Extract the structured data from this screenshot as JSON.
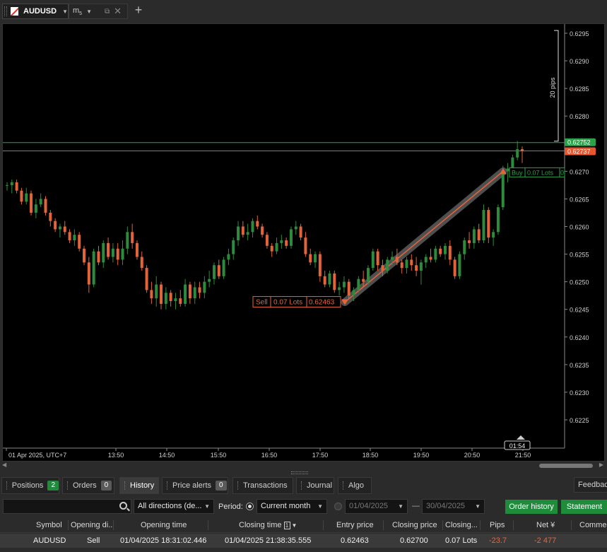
{
  "chart_tab": {
    "symbol": "AUDUSD",
    "timeframe_main": "m",
    "timeframe_sub": "5"
  },
  "chart": {
    "price_axis_labels": [
      "0.6295",
      "0.6290",
      "0.6285",
      "0.6280",
      "0.6270",
      "0.6265",
      "0.6260",
      "0.6255",
      "0.6250",
      "0.6245",
      "0.6240",
      "0.6235",
      "0.6230",
      "0.6225"
    ],
    "time_axis_labels": [
      "01 Apr 2025, UTC+7",
      "13:50",
      "14:50",
      "15:50",
      "16:50",
      "17:50",
      "18:50",
      "19:50",
      "20:50",
      "21:50"
    ],
    "ask_price_tag": "0.62752",
    "bid_price_tag": "0.62737",
    "pips_measure": "20 pips",
    "crosshair_time": "01:54",
    "sell_marker": {
      "side": "Sell",
      "lots": "0.07 Lots",
      "price": "0.62463"
    },
    "buy_marker": {
      "side": "Buy",
      "lots": "0.07 Lots",
      "extra": "0"
    },
    "colors": {
      "bull": "#2e8b3e",
      "bear": "#e2643a",
      "ask": "#2aa34a",
      "bid": "#e8552f"
    }
  },
  "chart_data": {
    "type": "candlestick",
    "candles": [
      [
        0.62675,
        0.6268,
        0.62665,
        0.62675
      ],
      [
        0.62675,
        0.62685,
        0.6266,
        0.6268
      ],
      [
        0.6268,
        0.62685,
        0.6266,
        0.62665
      ],
      [
        0.62665,
        0.6267,
        0.6264,
        0.62645
      ],
      [
        0.62645,
        0.6267,
        0.6264,
        0.6266
      ],
      [
        0.6266,
        0.62665,
        0.6262,
        0.62625
      ],
      [
        0.62625,
        0.6265,
        0.62615,
        0.6264
      ],
      [
        0.6264,
        0.6266,
        0.62635,
        0.6265
      ],
      [
        0.6265,
        0.62655,
        0.6262,
        0.62625
      ],
      [
        0.62625,
        0.6263,
        0.626,
        0.6261
      ],
      [
        0.6261,
        0.62615,
        0.6259,
        0.62595
      ],
      [
        0.62595,
        0.62605,
        0.6258,
        0.626
      ],
      [
        0.626,
        0.6261,
        0.62585,
        0.6259
      ],
      [
        0.6259,
        0.62595,
        0.6257,
        0.62575
      ],
      [
        0.62575,
        0.62595,
        0.62565,
        0.62585
      ],
      [
        0.62585,
        0.6259,
        0.62555,
        0.6256
      ],
      [
        0.6256,
        0.62565,
        0.6253,
        0.62535
      ],
      [
        0.62535,
        0.62545,
        0.6248,
        0.62495
      ],
      [
        0.62495,
        0.6256,
        0.6249,
        0.62555
      ],
      [
        0.62555,
        0.62565,
        0.6253,
        0.62535
      ],
      [
        0.62535,
        0.62575,
        0.62525,
        0.6257
      ],
      [
        0.6257,
        0.6258,
        0.6254,
        0.62545
      ],
      [
        0.62545,
        0.6257,
        0.62535,
        0.6256
      ],
      [
        0.6256,
        0.6257,
        0.6253,
        0.6254
      ],
      [
        0.6254,
        0.62575,
        0.6253,
        0.6256
      ],
      [
        0.6256,
        0.626,
        0.6255,
        0.6259
      ],
      [
        0.6259,
        0.62605,
        0.6256,
        0.6257
      ],
      [
        0.6257,
        0.62575,
        0.6254,
        0.62545
      ],
      [
        0.62545,
        0.62555,
        0.6252,
        0.62525
      ],
      [
        0.62525,
        0.6253,
        0.6248,
        0.62485
      ],
      [
        0.62485,
        0.625,
        0.6246,
        0.6247
      ],
      [
        0.6247,
        0.6251,
        0.62455,
        0.62495
      ],
      [
        0.62495,
        0.625,
        0.6245,
        0.6246
      ],
      [
        0.6246,
        0.6249,
        0.6245,
        0.6248
      ],
      [
        0.6248,
        0.62485,
        0.62455,
        0.62465
      ],
      [
        0.62465,
        0.6248,
        0.6245,
        0.6247
      ],
      [
        0.6247,
        0.62485,
        0.62455,
        0.6246
      ],
      [
        0.6246,
        0.62505,
        0.62455,
        0.62495
      ],
      [
        0.62495,
        0.625,
        0.6246,
        0.6247
      ],
      [
        0.6247,
        0.625,
        0.6246,
        0.6249
      ],
      [
        0.6249,
        0.625,
        0.6247,
        0.6248
      ],
      [
        0.6248,
        0.6251,
        0.6247,
        0.625
      ],
      [
        0.625,
        0.6252,
        0.6249,
        0.62505
      ],
      [
        0.62505,
        0.62535,
        0.62495,
        0.6253
      ],
      [
        0.6253,
        0.6254,
        0.62505,
        0.6251
      ],
      [
        0.6251,
        0.62545,
        0.62505,
        0.6254
      ],
      [
        0.6254,
        0.6256,
        0.6253,
        0.6255
      ],
      [
        0.6255,
        0.6258,
        0.6254,
        0.62575
      ],
      [
        0.62575,
        0.6261,
        0.62565,
        0.626
      ],
      [
        0.626,
        0.6261,
        0.6258,
        0.62585
      ],
      [
        0.62585,
        0.62605,
        0.62575,
        0.6259
      ],
      [
        0.6259,
        0.62615,
        0.6258,
        0.6261
      ],
      [
        0.6261,
        0.6262,
        0.62595,
        0.626
      ],
      [
        0.626,
        0.62605,
        0.6258,
        0.62585
      ],
      [
        0.62585,
        0.6259,
        0.6256,
        0.62565
      ],
      [
        0.62565,
        0.6257,
        0.62545,
        0.62555
      ],
      [
        0.62555,
        0.6258,
        0.6255,
        0.6257
      ],
      [
        0.6257,
        0.62585,
        0.6256,
        0.62575
      ],
      [
        0.62575,
        0.6258,
        0.6256,
        0.62565
      ],
      [
        0.62565,
        0.626,
        0.6256,
        0.62595
      ],
      [
        0.62595,
        0.6261,
        0.62585,
        0.626
      ],
      [
        0.626,
        0.62605,
        0.62575,
        0.6258
      ],
      [
        0.6258,
        0.6259,
        0.62545,
        0.6255
      ],
      [
        0.6255,
        0.6256,
        0.6253,
        0.62535
      ],
      [
        0.62535,
        0.62555,
        0.62525,
        0.6255
      ],
      [
        0.6255,
        0.62555,
        0.625,
        0.6251
      ],
      [
        0.6251,
        0.6252,
        0.6249,
        0.62495
      ],
      [
        0.62495,
        0.6252,
        0.6249,
        0.62515
      ],
      [
        0.62515,
        0.6252,
        0.6248,
        0.62485
      ],
      [
        0.62485,
        0.625,
        0.62475,
        0.6249
      ],
      [
        0.6249,
        0.6251,
        0.6248,
        0.625
      ],
      [
        0.625,
        0.62505,
        0.6247,
        0.62475
      ],
      [
        0.62475,
        0.6249,
        0.62465,
        0.62485
      ],
      [
        0.62485,
        0.6251,
        0.6248,
        0.62505
      ],
      [
        0.62505,
        0.6252,
        0.6249,
        0.625
      ],
      [
        0.625,
        0.6253,
        0.62495,
        0.62525
      ],
      [
        0.62525,
        0.6256,
        0.6252,
        0.62555
      ],
      [
        0.62555,
        0.6256,
        0.6252,
        0.6253
      ],
      [
        0.6253,
        0.6254,
        0.6251,
        0.6252
      ],
      [
        0.6252,
        0.62545,
        0.62515,
        0.6254
      ],
      [
        0.6254,
        0.62555,
        0.6253,
        0.62545
      ],
      [
        0.62545,
        0.6256,
        0.6253,
        0.62535
      ],
      [
        0.62535,
        0.6254,
        0.62515,
        0.62525
      ],
      [
        0.62525,
        0.62545,
        0.62515,
        0.6254
      ],
      [
        0.6254,
        0.6255,
        0.6252,
        0.6253
      ],
      [
        0.6253,
        0.62545,
        0.6251,
        0.6252
      ],
      [
        0.6252,
        0.6254,
        0.62495,
        0.62535
      ],
      [
        0.62535,
        0.6255,
        0.62525,
        0.62545
      ],
      [
        0.62545,
        0.6256,
        0.62535,
        0.6254
      ],
      [
        0.6254,
        0.62565,
        0.62535,
        0.6256
      ],
      [
        0.6256,
        0.62565,
        0.62545,
        0.6255
      ],
      [
        0.6255,
        0.6257,
        0.6254,
        0.62565
      ],
      [
        0.62565,
        0.62575,
        0.6253,
        0.6254
      ],
      [
        0.6254,
        0.62545,
        0.62505,
        0.6251
      ],
      [
        0.6251,
        0.62555,
        0.62505,
        0.6255
      ],
      [
        0.6255,
        0.6258,
        0.6254,
        0.62575
      ],
      [
        0.62575,
        0.6259,
        0.6256,
        0.6257
      ],
      [
        0.6257,
        0.626,
        0.6256,
        0.62595
      ],
      [
        0.62595,
        0.62605,
        0.6257,
        0.62575
      ],
      [
        0.62575,
        0.6264,
        0.6257,
        0.6263
      ],
      [
        0.6263,
        0.62635,
        0.6257,
        0.6258
      ],
      [
        0.6258,
        0.62595,
        0.62565,
        0.6259
      ],
      [
        0.6259,
        0.6264,
        0.62585,
        0.62635
      ],
      [
        0.62635,
        0.6271,
        0.6263,
        0.627
      ],
      [
        0.627,
        0.62715,
        0.6268,
        0.62705
      ],
      [
        0.62705,
        0.6273,
        0.627,
        0.62725
      ],
      [
        0.62725,
        0.62755,
        0.6272,
        0.6274
      ],
      [
        0.6274,
        0.62745,
        0.62715,
        0.62737
      ]
    ],
    "ylim": [
      0.622,
      0.6297
    ],
    "xlabel": "",
    "ylabel": ""
  },
  "bottom_tabs": [
    {
      "label": "Positions",
      "badge": "2"
    },
    {
      "label": "Orders",
      "badge": "0"
    },
    {
      "label": "History"
    },
    {
      "label": "Price alerts",
      "badge": "0"
    },
    {
      "label": "Transactions"
    },
    {
      "label": "Journal"
    },
    {
      "label": "Algo"
    }
  ],
  "feedback_label": "Feedback",
  "filters": {
    "direction": "All directions (de...",
    "period_label": "Period:",
    "period_value": "Current month",
    "date_from": "01/04/2025",
    "date_sep": "—",
    "date_to": "30/04/2025",
    "order_history_btn": "Order history",
    "statement_btn": "Statement"
  },
  "table": {
    "headers": [
      "Symbol",
      "Opening di..",
      "Opening time",
      "Closing time",
      "Entry price",
      "Closing price",
      "Closing...",
      "Pips",
      "Net ¥",
      "Commen"
    ],
    "sort_indicator": "1",
    "row": {
      "info": "i",
      "symbol": "AUDUSD",
      "direction": "Sell",
      "opening_time": "01/04/2025 18:31:02.446",
      "closing_time": "01/04/2025 21:38:35.555",
      "entry_price": "0.62463",
      "closing_price": "0.62700",
      "closing_qty": "0.07 Lots",
      "pips": "-23.7",
      "net": "-2 477"
    }
  }
}
